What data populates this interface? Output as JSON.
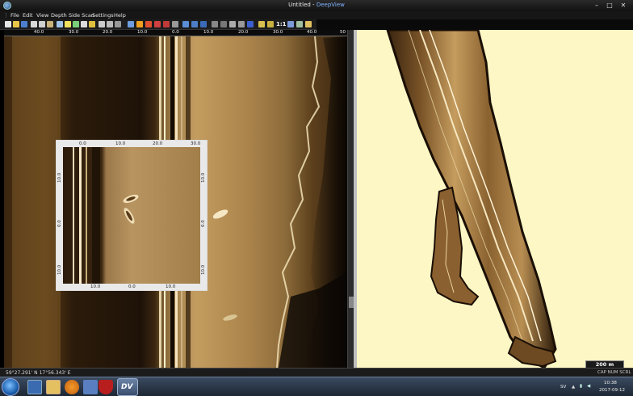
{
  "window": {
    "title_doc": "Untitled",
    "title_sep": " - ",
    "title_app": "DeepView"
  },
  "window_controls": {
    "minimize": "–",
    "maximize": "□",
    "close": "✕"
  },
  "menu": [
    "File",
    "Edit",
    "View",
    "Depth",
    "Side Scan",
    "Settings",
    "Help"
  ],
  "toolbar": {
    "zoom_ratio": "1:1"
  },
  "sonar_ruler_top": [
    "40.0",
    "30.0",
    "20.0",
    "10.0",
    "0.0",
    "10.0",
    "20.0",
    "30.0",
    "40.0",
    "50"
  ],
  "inset": {
    "ruler_top": [
      "0.0",
      "10.0",
      "20.0",
      "30.0"
    ],
    "ruler_bottom": [
      "10.0",
      "0.0",
      "10.0"
    ],
    "ruler_left": [
      "10.0",
      "0.0",
      "10.0"
    ],
    "ruler_right": [
      "10.0",
      "0.0",
      "10.0"
    ]
  },
  "map": {
    "scale": "200 m"
  },
  "status": {
    "coords": "59°27.291' N  17°56.343' E",
    "num": "CAP  NUM  SCRL"
  },
  "taskbar": {
    "tray": {
      "language": "SV",
      "time": "10:38",
      "date": "2017-09-12"
    },
    "active_app_label": "DV"
  },
  "colors": {
    "map_bg": "#fdf7c5",
    "sonar_dark": "#201409",
    "sonar_light": "#c9a568",
    "accent": "#7fb2ff"
  }
}
